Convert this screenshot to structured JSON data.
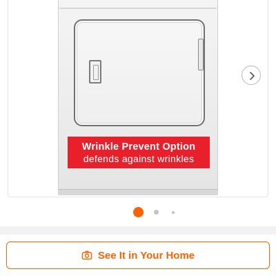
{
  "promo": {
    "line1": "Wrinkle Prevent Option",
    "line2": "defends against wrinkles"
  },
  "carousel": {
    "slide_count_indicators": 3,
    "active_index": 0
  },
  "actions": {
    "see_home_label": "See It in Your Home"
  },
  "colors": {
    "accent": "#f96302",
    "banner": "#e8202c",
    "dot_inactive": "#c4c4c4"
  },
  "icons": {
    "next": "chevron-right-icon",
    "camera": "camera-icon"
  }
}
